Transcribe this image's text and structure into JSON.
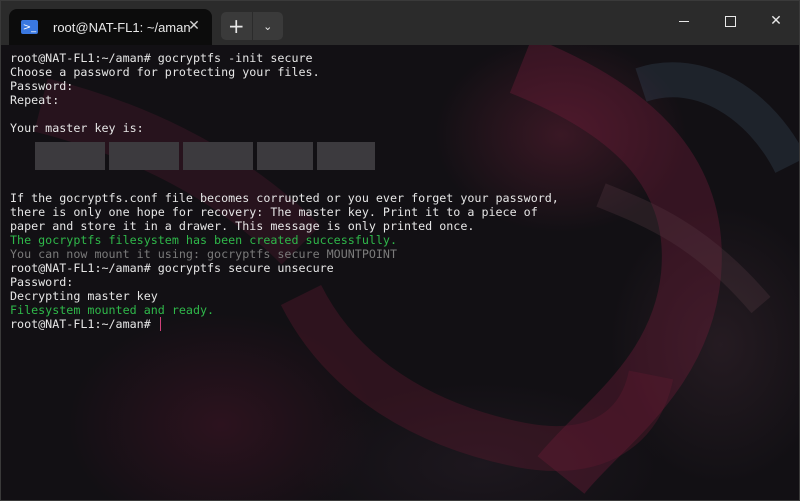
{
  "window": {
    "tab_title": "root@NAT-FL1: ~/aman",
    "tab_icon": "terminal-icon",
    "new_tab_label": "+",
    "dropdown_label": "⌄",
    "close_tab_label": "✕"
  },
  "terminal": {
    "lines": [
      {
        "text": "root@NAT-FL1:~/aman# gocryptfs -init secure",
        "style": "normal"
      },
      {
        "text": "Choose a password for protecting your files.",
        "style": "normal"
      },
      {
        "text": "Password:",
        "style": "normal"
      },
      {
        "text": "Repeat:",
        "style": "normal"
      },
      {
        "text": "",
        "style": "normal"
      },
      {
        "text": "Your master key is:",
        "style": "normal"
      },
      {
        "text": "",
        "style": "normal"
      },
      {
        "text": "",
        "style": "redacted"
      },
      {
        "text": "",
        "style": "normal"
      },
      {
        "text": "",
        "style": "normal"
      },
      {
        "text": "If the gocryptfs.conf file becomes corrupted or you ever forget your password,",
        "style": "normal"
      },
      {
        "text": "there is only one hope for recovery: The master key. Print it to a piece of",
        "style": "normal"
      },
      {
        "text": "paper and store it in a drawer. This message is only printed once.",
        "style": "normal"
      },
      {
        "text": "The gocryptfs filesystem has been created successfully.",
        "style": "green"
      },
      {
        "text": "You can now mount it using: gocryptfs secure MOUNTPOINT",
        "style": "dim"
      },
      {
        "text": "root@NAT-FL1:~/aman# gocryptfs secure unsecure",
        "style": "normal"
      },
      {
        "text": "Password:",
        "style": "normal"
      },
      {
        "text": "Decrypting master key",
        "style": "normal"
      },
      {
        "text": "Filesystem mounted and ready.",
        "style": "green"
      },
      {
        "text": "root@NAT-FL1:~/aman# ",
        "style": "prompt"
      }
    ],
    "colors": {
      "text": "#e6e6e6",
      "green": "#2fb84a",
      "dim": "#7a7a7a",
      "cursor": "#d0407a"
    }
  }
}
